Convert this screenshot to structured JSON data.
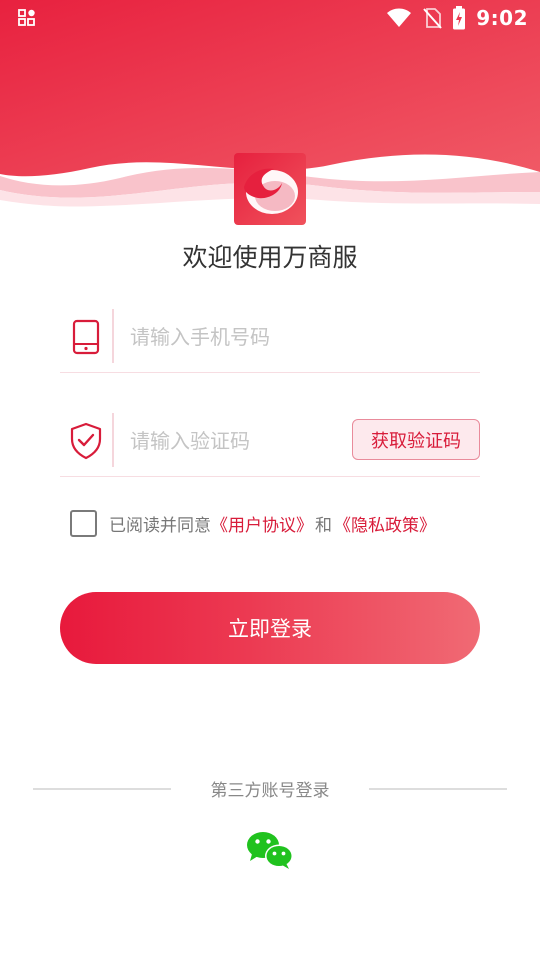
{
  "status_bar": {
    "time": "9:02"
  },
  "colors": {
    "brand": "#e8193c",
    "brand_light": "#f06a74",
    "wechat": "#20c21e"
  },
  "header": {
    "welcome": "欢迎使用万商服"
  },
  "login_form": {
    "phone_placeholder": "请输入手机号码",
    "code_placeholder": "请输入验证码",
    "get_code_label": "获取验证码",
    "agreement": {
      "prefix": "已阅读并同意",
      "user_agreement": "《用户协议》",
      "and": "和",
      "privacy_policy": "《隐私政策》"
    },
    "login_label": "立即登录"
  },
  "third_party": {
    "label": "第三方账号登录",
    "providers": [
      "wechat-icon"
    ]
  }
}
